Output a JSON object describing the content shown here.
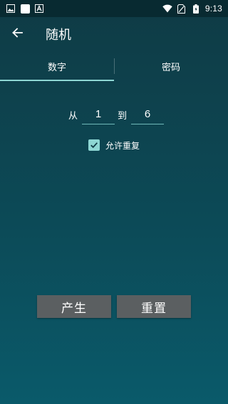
{
  "status_bar": {
    "time": "9:13",
    "icons": [
      "image-icon",
      "square-icon",
      "a-icon",
      "wifi-icon",
      "no-sim-icon",
      "battery-icon"
    ]
  },
  "toolbar": {
    "title": "随机",
    "back_icon": "arrow-left-icon"
  },
  "tabs": [
    {
      "label": "数字",
      "active": true
    },
    {
      "label": "密码",
      "active": false
    }
  ],
  "range": {
    "from_label": "从",
    "from_value": "1",
    "to_label": "到",
    "to_value": "6"
  },
  "repeat": {
    "label": "允许重复",
    "checked": true
  },
  "actions": {
    "generate_label": "产生",
    "reset_label": "重置"
  },
  "colors": {
    "accent": "#8ed7d4",
    "background_top": "#0f3b45",
    "background_bottom": "#0a5a6a",
    "button": "#5b5f61"
  }
}
